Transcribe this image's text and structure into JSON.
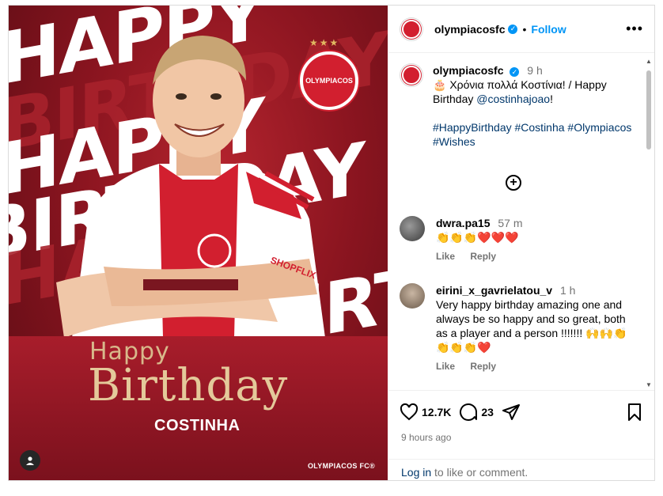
{
  "image": {
    "bg_words": [
      "HAPPY",
      "BIRTHDAY"
    ],
    "happy": "Happy",
    "birthday": "Birthday",
    "player_name": "COSTINHA",
    "brand": "OLYMPIACOS FC®",
    "crest_text": "OLYMPIACOS",
    "sponsor": "SHOPFLIX",
    "accent": "#d21f2f",
    "gold": "#e4c99a"
  },
  "header": {
    "username": "olympiacosfc",
    "separator": "•",
    "follow": "Follow",
    "more": "•••"
  },
  "caption": {
    "username": "olympiacosfc",
    "time": "9 h",
    "emoji": "🎂",
    "text": "Χρόνια πολλά Κοστίνια! / Happy Birthday",
    "mention": "@costinhajoao",
    "after_mention": "!",
    "hashtags": "#HappyBirthday #Costinha #Olympiacos #Wishes"
  },
  "comments": [
    {
      "username": "dwra.pa15",
      "time": "57 m",
      "text": "👏👏👏❤️❤️❤️",
      "like": "Like",
      "reply": "Reply"
    },
    {
      "username": "eirini_x_gavrielatou_v",
      "time": "1 h",
      "text": "Very happy birthday amazing one and always be so happy and so great, both as a player and a person !!!!!!! 🙌🙌👏👏👏👏❤️",
      "like": "Like",
      "reply": "Reply"
    }
  ],
  "actions": {
    "likes": "12.7K",
    "comments": "23",
    "posted": "9 hours ago"
  },
  "login": {
    "link": "Log in",
    "rest": " to like or comment."
  }
}
